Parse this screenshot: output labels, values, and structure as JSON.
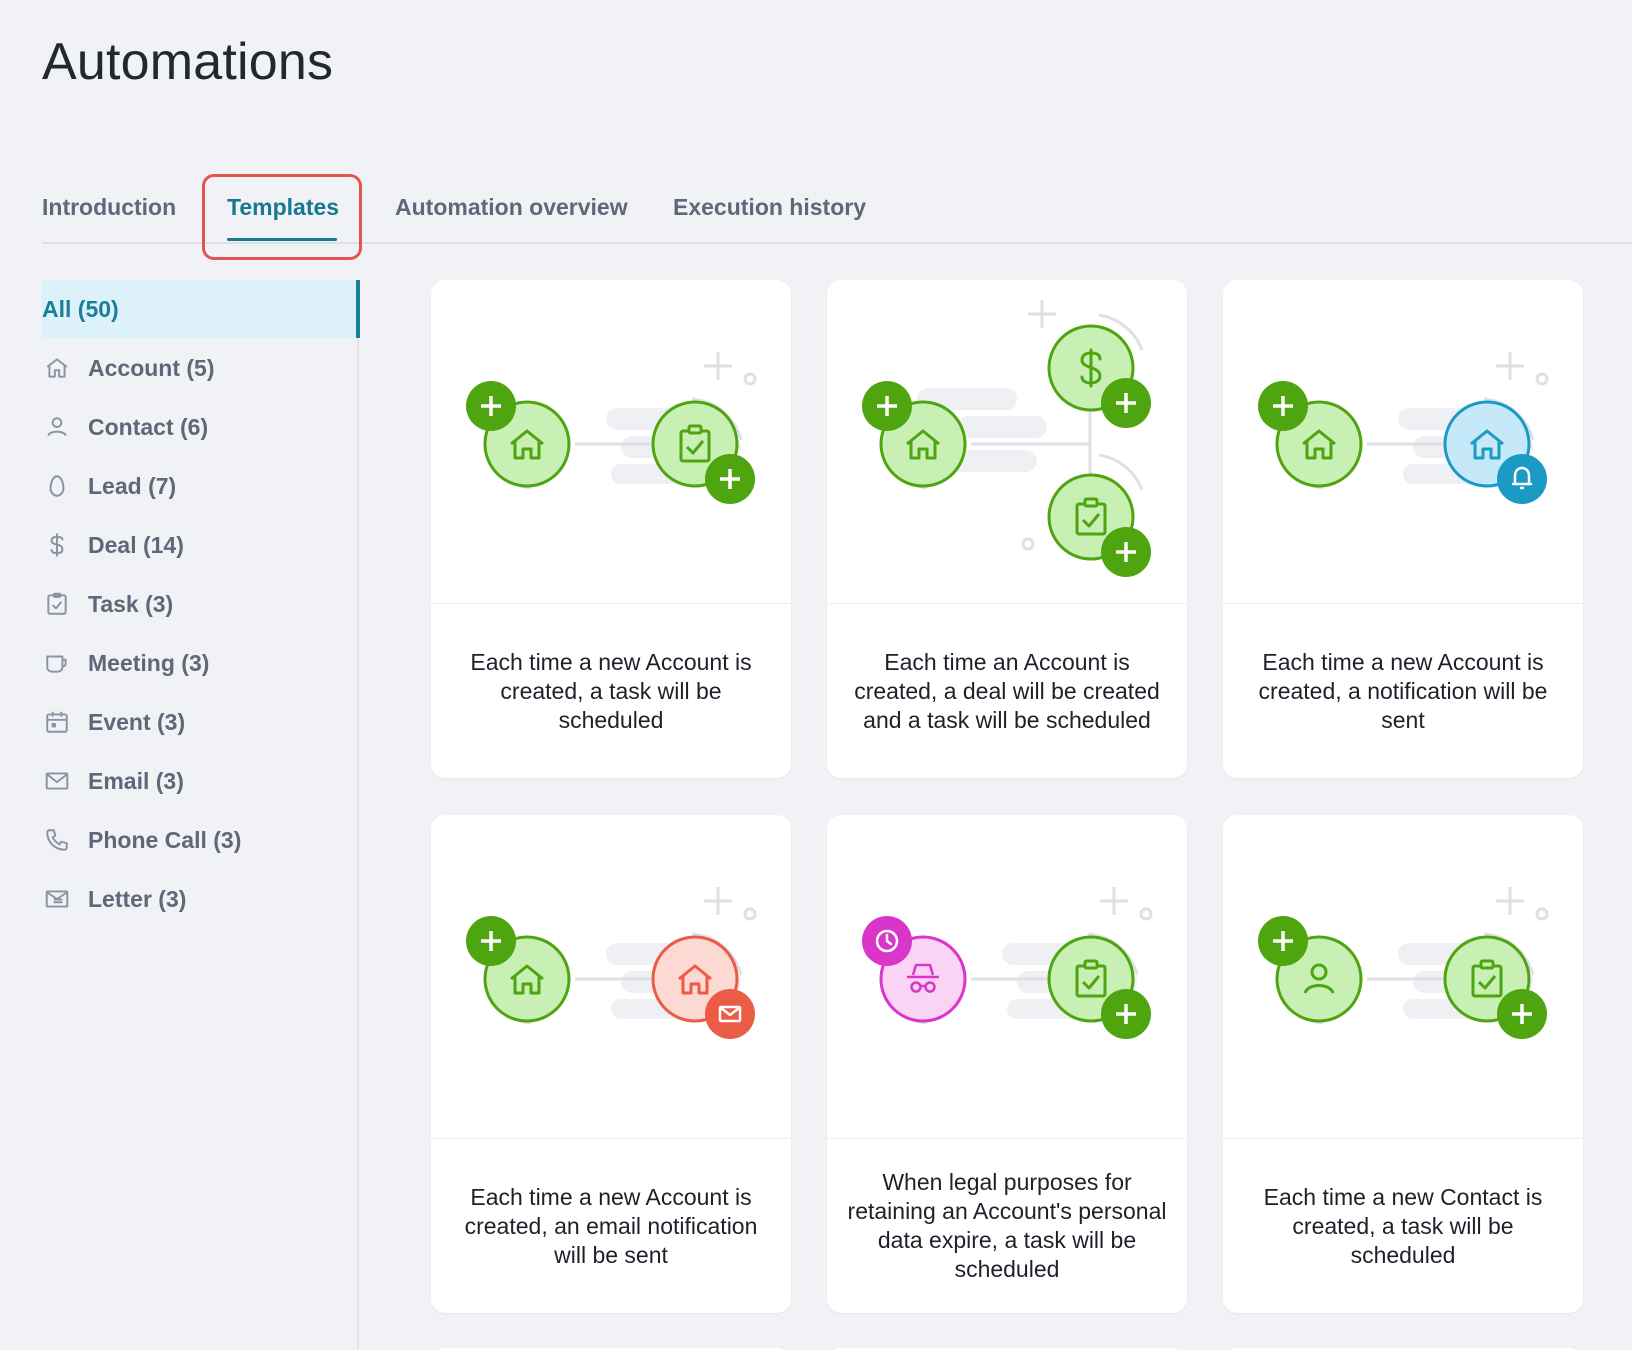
{
  "page": {
    "title": "Automations"
  },
  "tabs": [
    {
      "label": "Introduction",
      "active": false
    },
    {
      "label": "Templates",
      "active": true
    },
    {
      "label": "Automation overview",
      "active": false
    },
    {
      "label": "Execution history",
      "active": false
    }
  ],
  "sidebar": {
    "items": [
      {
        "label": "All (50)",
        "icon": "",
        "active": true
      },
      {
        "label": "Account (5)",
        "icon": "home-icon"
      },
      {
        "label": "Contact (6)",
        "icon": "user-icon"
      },
      {
        "label": "Lead (7)",
        "icon": "egg-icon"
      },
      {
        "label": "Deal (14)",
        "icon": "dollar-icon"
      },
      {
        "label": "Task (3)",
        "icon": "clipboard-check-icon"
      },
      {
        "label": "Meeting (3)",
        "icon": "mug-icon"
      },
      {
        "label": "Event (3)",
        "icon": "calendar-icon"
      },
      {
        "label": "Email (3)",
        "icon": "envelope-icon"
      },
      {
        "label": "Phone Call (3)",
        "icon": "phone-icon"
      },
      {
        "label": "Letter (3)",
        "icon": "letter-icon"
      }
    ]
  },
  "templates": [
    {
      "description": "Each time a new Account is created, a task will be scheduled"
    },
    {
      "description": "Each time an Account is created, a deal will be created and a task will be scheduled"
    },
    {
      "description": "Each time a new Account is created, a notification will be sent"
    },
    {
      "description": "Each time a new Account is created, an email notification will be sent"
    },
    {
      "description": "When legal purposes for retaining an Account's personal data expire, a task will be scheduled"
    },
    {
      "description": "Each time a new Contact is created, a task will be scheduled"
    }
  ],
  "colors": {
    "accent": "#17798d",
    "highlight": "#e0574f",
    "green": "#4fa50f",
    "green_light": "#c8f0b4",
    "blue": "#1a9ac4",
    "red": "#ec5b45",
    "pink": "#d936c9"
  }
}
